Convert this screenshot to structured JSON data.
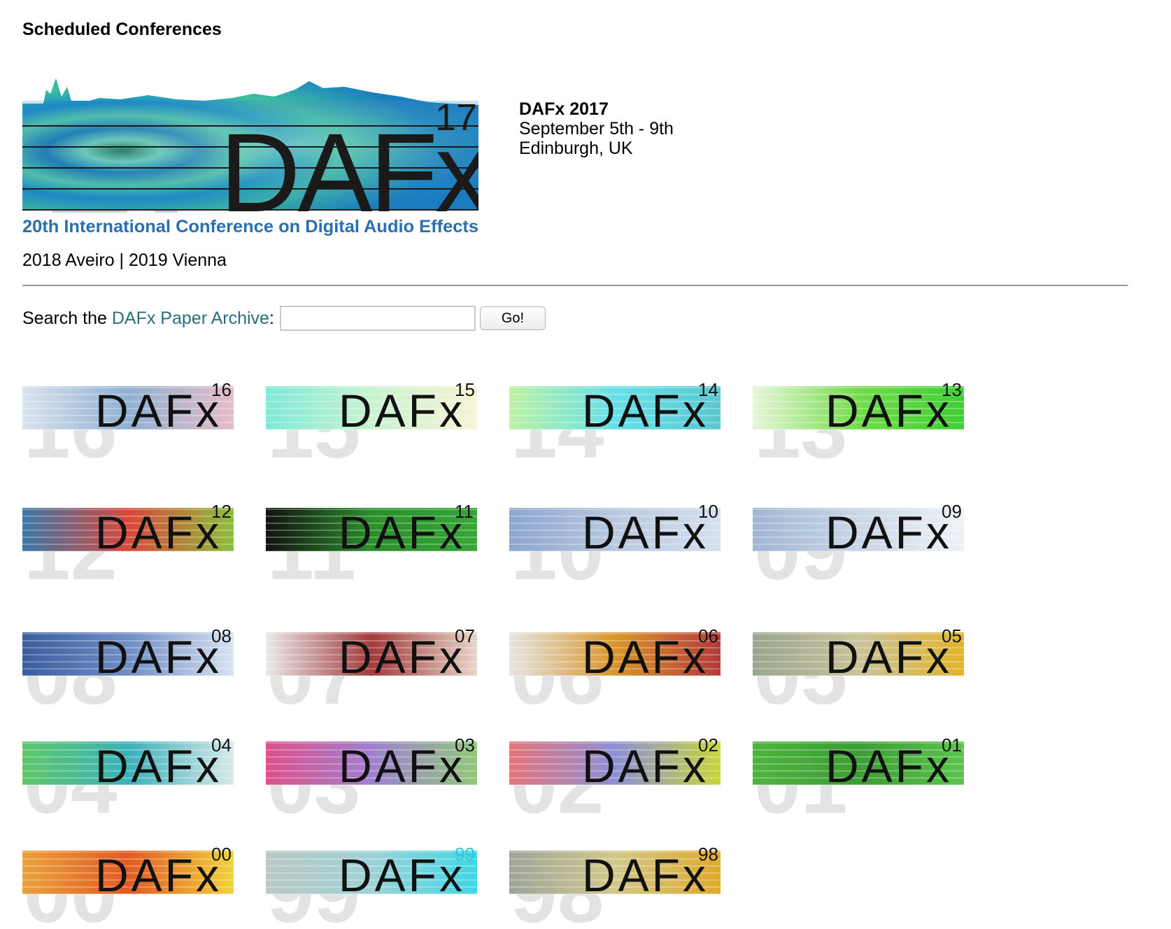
{
  "heading": "Scheduled Conferences",
  "current": {
    "logo": {
      "big_number": "17",
      "word": "DAFx",
      "superscript": "17",
      "subtitle": "20th International Conference on Digital Audio Effects"
    },
    "title": "DAFx 2017",
    "dates": "September 5th - 9th",
    "location": "Edinburgh, UK"
  },
  "upcoming": "2018 Aveiro | 2019 Vienna",
  "search": {
    "prefix": "Search the ",
    "link_text": "DAFx Paper Archive",
    "suffix": ":",
    "input_value": "",
    "button_label": "Go!"
  },
  "archive_logos": [
    {
      "word": "DAFx",
      "year": "16",
      "colors": [
        "#d9e3ee",
        "#8fb1d1",
        "#e7bcc7"
      ],
      "ghost": "16"
    },
    {
      "word": "DAFx",
      "year": "15",
      "colors": [
        "#7fe9d9",
        "#c8f3cf",
        "#f7f3d7"
      ],
      "ghost": "15"
    },
    {
      "word": "DAFx",
      "year": "14",
      "colors": [
        "#bdf2a4",
        "#66e0e8",
        "#5cc8d0"
      ],
      "ghost": "14"
    },
    {
      "word": "DAFx",
      "year": "13",
      "colors": [
        "#e8f6d9",
        "#73dc4b",
        "#3fce35"
      ],
      "ghost": "13"
    },
    {
      "word": "DAFx",
      "year": "12",
      "colors": [
        "#3a78a8",
        "#d9483a",
        "#8bbf3a"
      ],
      "ghost": "12"
    },
    {
      "word": "DAFx",
      "year": "11",
      "colors": [
        "#111111",
        "#2a8f2a",
        "#36a736"
      ],
      "ghost": "11"
    },
    {
      "word": "DAFx",
      "year": "10",
      "colors": [
        "#8ca6cf",
        "#b8c8df",
        "#d6e0ee"
      ],
      "ghost": "10"
    },
    {
      "word": "DAFx",
      "year": "09",
      "colors": [
        "#9fb6d2",
        "#c9d6e6",
        "#eef2f7"
      ],
      "ghost": "09"
    },
    {
      "word": "DAFx",
      "year": "08",
      "colors": [
        "#3a5d9e",
        "#6f8ec4",
        "#d8e2f2"
      ],
      "ghost": "08"
    },
    {
      "word": "DAFx",
      "year": "07",
      "colors": [
        "#e9e9e9",
        "#a23a3a",
        "#e7d4c8"
      ],
      "ghost": "07"
    },
    {
      "word": "DAFx",
      "year": "06",
      "colors": [
        "#e5e5e5",
        "#d9962a",
        "#b23a3a"
      ],
      "ghost": "06"
    },
    {
      "word": "DAFx",
      "year": "05",
      "colors": [
        "#9aa58f",
        "#c8c39a",
        "#e3b32a"
      ],
      "ghost": "05"
    },
    {
      "word": "DAFx",
      "year": "04",
      "colors": [
        "#5ec76a",
        "#3ab1b9",
        "#d9e8ea"
      ],
      "ghost": "04"
    },
    {
      "word": "DAFx",
      "year": "03",
      "colors": [
        "#e0508a",
        "#9f7fcf",
        "#8fc97a"
      ],
      "ghost": "03"
    },
    {
      "word": "DAFx",
      "year": "02",
      "colors": [
        "#e5737a",
        "#8e90d6",
        "#c7d63a"
      ],
      "ghost": "02"
    },
    {
      "word": "DAFx",
      "year": "01",
      "colors": [
        "#4fb43f",
        "#3c9d34",
        "#5bc44d"
      ],
      "ghost": "01"
    },
    {
      "word": "DAFx",
      "year": "00",
      "colors": [
        "#e9a23a",
        "#e25a26",
        "#f2d33a"
      ],
      "ghost": "00"
    },
    {
      "word": "DAFx",
      "year": "99",
      "colors": [
        "#b9c9c4",
        "#9fd2d6",
        "#3fd7e6"
      ],
      "ghost": "99"
    },
    {
      "word": "DAFx",
      "year": "98",
      "colors": [
        "#9ea59a",
        "#d2c88c",
        "#e0a92a"
      ],
      "ghost": "98"
    }
  ]
}
